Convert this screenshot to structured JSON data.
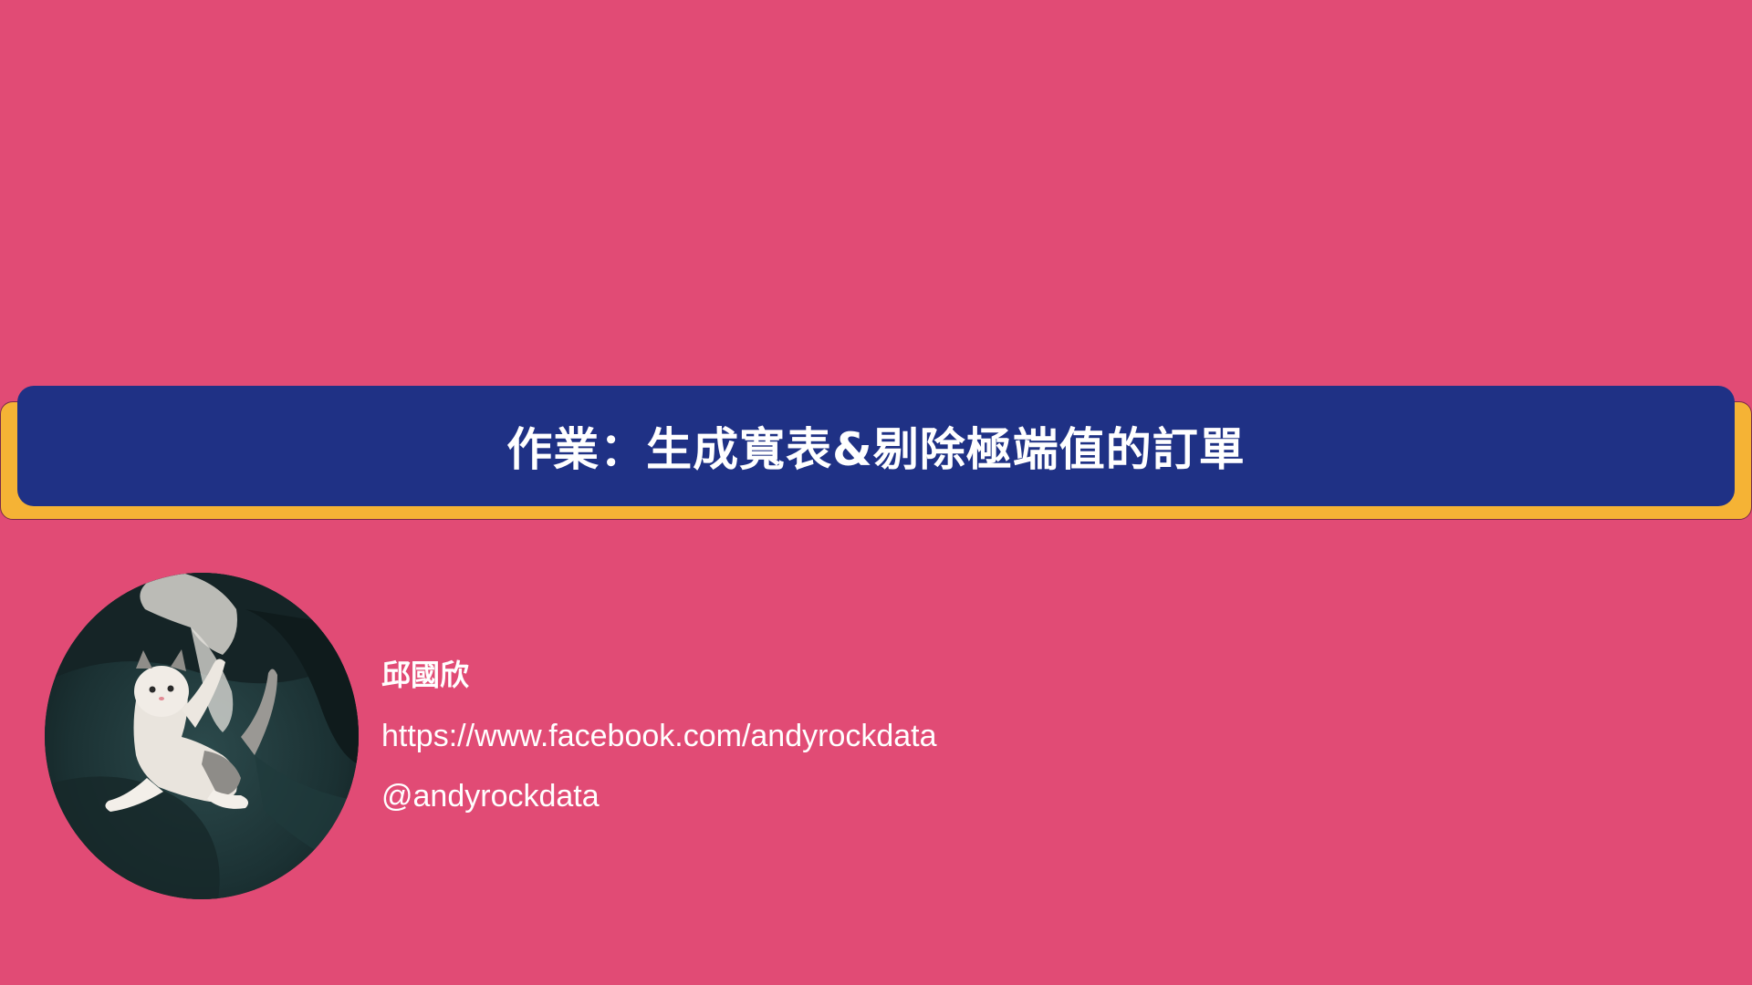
{
  "slide": {
    "title": "作業：生成寬表&剔除極端值的訂單",
    "background_color": "#E14B75",
    "banner_color": "#1F3185",
    "banner_shadow_color": "#F5B335"
  },
  "author": {
    "avatar_icon": "kitten-photo",
    "name": "邱國欣",
    "link": "https://www.facebook.com/andyrockdata",
    "handle": "@andyrockdata"
  }
}
